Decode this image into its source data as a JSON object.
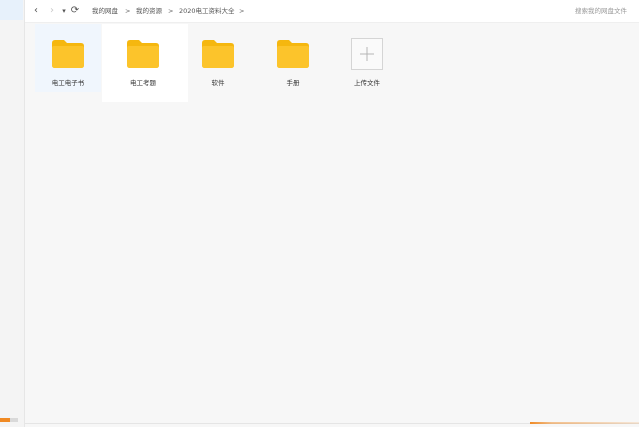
{
  "nav": {
    "back_glyph": "‹",
    "forward_glyph": "›",
    "dropdown_glyph": "▾",
    "refresh_glyph": "⟳"
  },
  "breadcrumb": {
    "items": [
      "我的网盘",
      "我的资源",
      "2020电工资料大全"
    ],
    "separator": ">"
  },
  "search": {
    "placeholder": "搜索我的网盘文件"
  },
  "files": [
    {
      "name": "电工电子书",
      "icon": "folder-icon"
    },
    {
      "name": "电工考题",
      "icon": "folder-icon"
    },
    {
      "name": "软件",
      "icon": "folder-icon"
    },
    {
      "name": "手册",
      "icon": "folder-icon"
    }
  ],
  "upload": {
    "label": "上传文件",
    "icon": "plus-icon"
  },
  "colors": {
    "folder": "#fcc42b",
    "folder_tab": "#f5b70f",
    "accent": "#f08a24"
  },
  "storage": {
    "used_fraction": 0.55
  }
}
